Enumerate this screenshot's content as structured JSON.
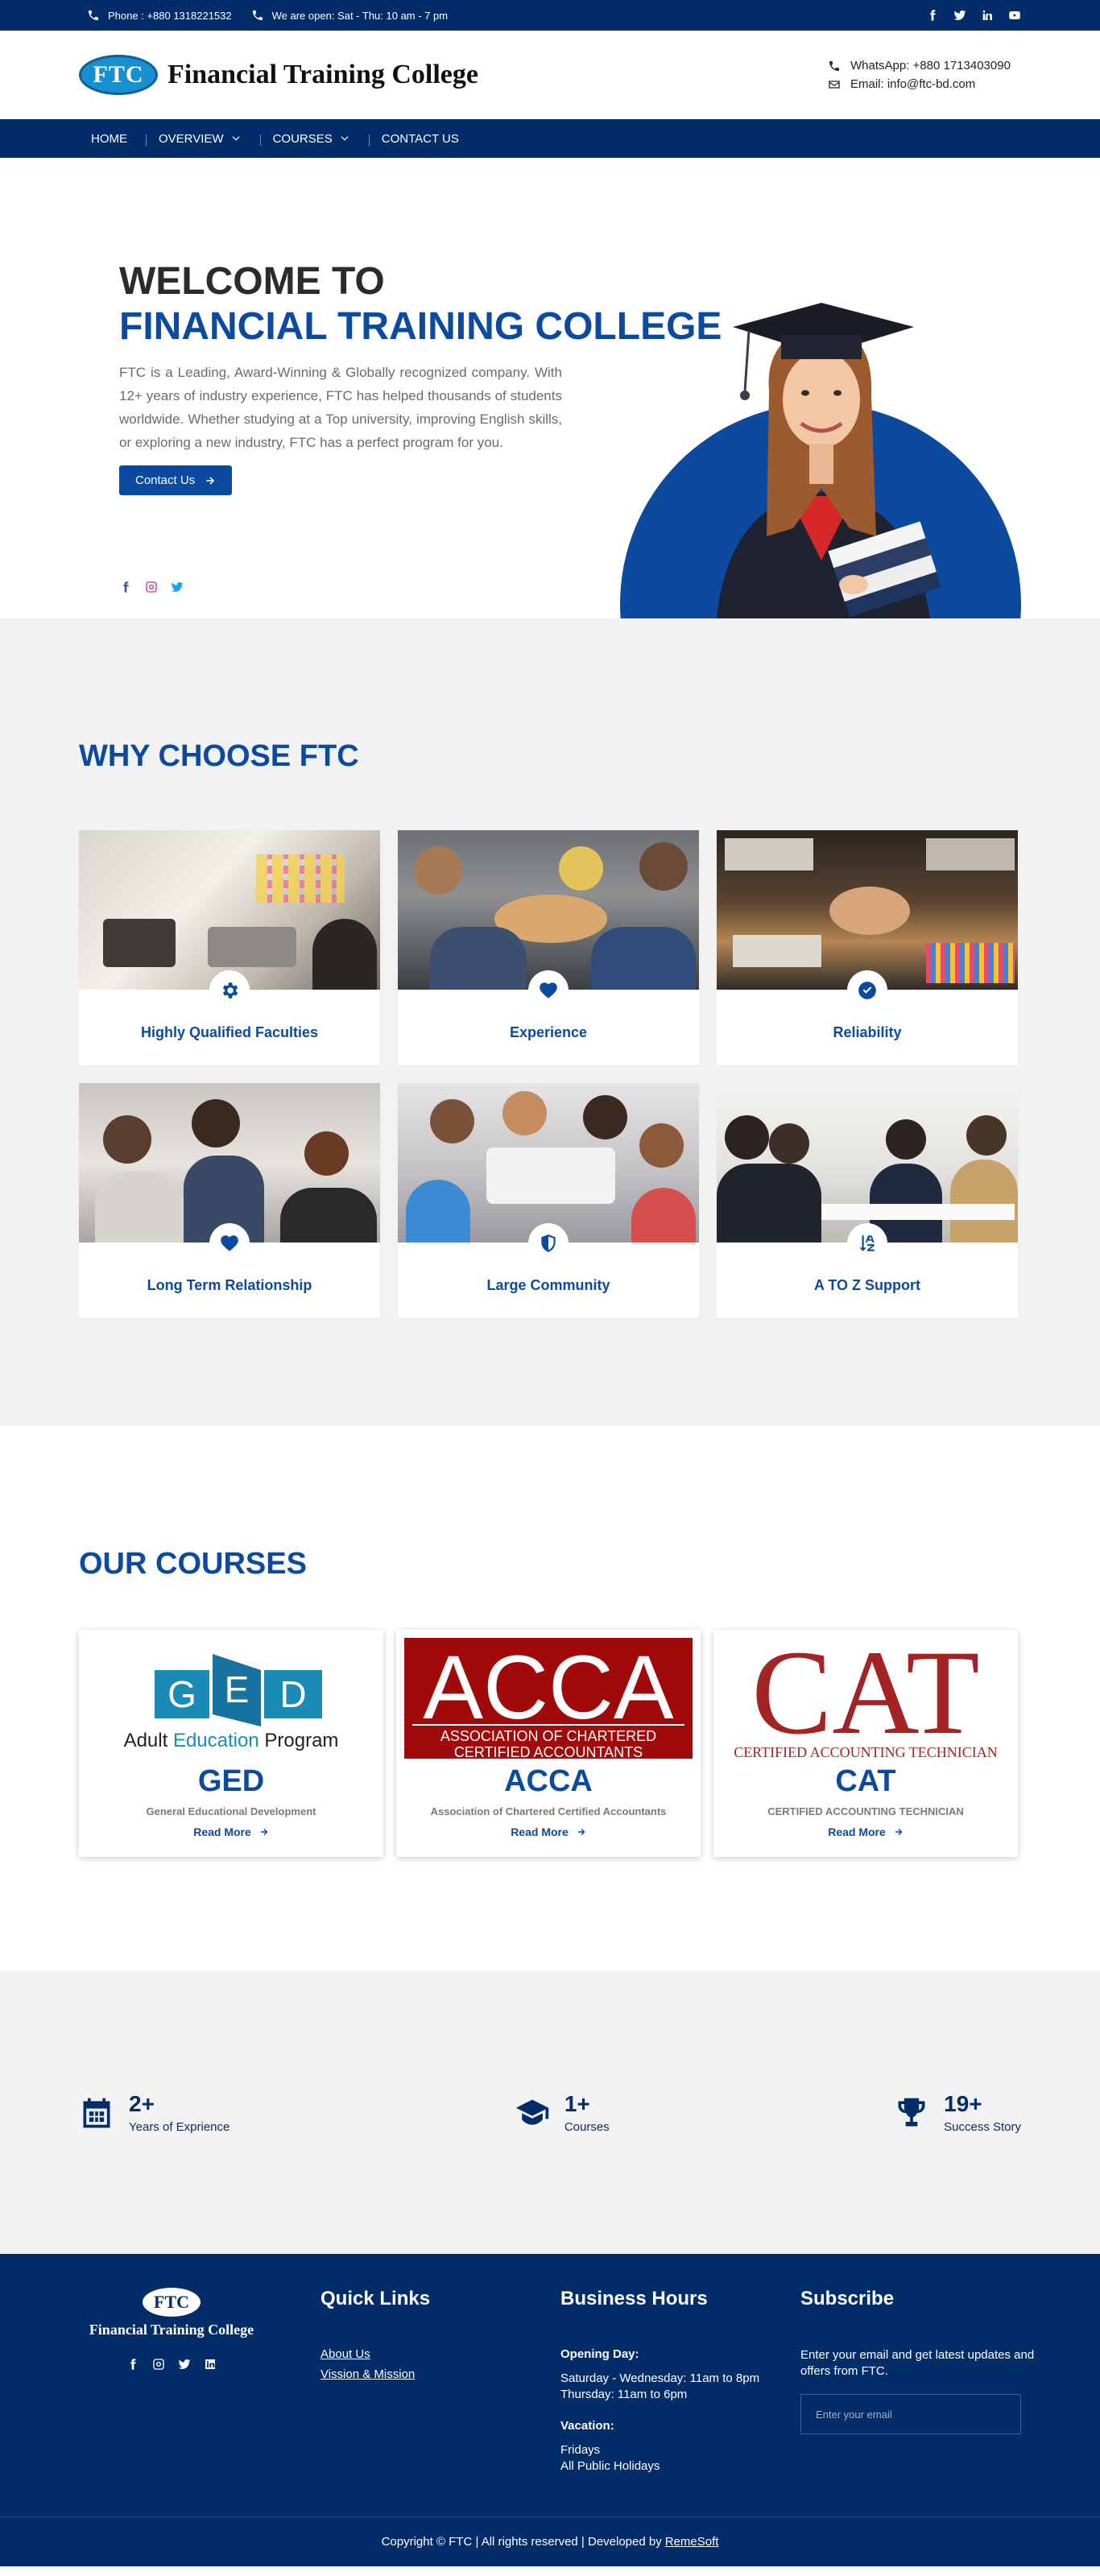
{
  "topbar": {
    "phone": "Phone : +880 1318221532",
    "hours": "We are open: Sat - Thu: 10 am - 7 pm"
  },
  "header": {
    "logo_abbr": "FTC",
    "logo_name": "Financial Training College",
    "whatsapp": "WhatsApp: +880 1713403090",
    "email": "Email: info@ftc-bd.com"
  },
  "nav": {
    "home": "HOME",
    "overview": "OVERVIEW",
    "courses": "COURSES",
    "contact": "CONTACT US"
  },
  "hero": {
    "line1": "WELCOME TO",
    "line2": "FINANCIAL TRAINING COLLEGE",
    "description": "FTC is a Leading, Award-Winning & Globally recognized company. With 12+ years of industry experience, FTC has helped thousands of students worldwide. Whether studying at a Top university, improving English skills, or exploring a new industry, FTC has a perfect program for you.",
    "cta": "Contact Us"
  },
  "why": {
    "title": "WHY CHOOSE FTC",
    "cards": [
      {
        "title": "Highly Qualified Faculties",
        "icon": "gear-icon"
      },
      {
        "title": "Experience",
        "icon": "heart-icon"
      },
      {
        "title": "Reliability",
        "icon": "check-circle-icon"
      },
      {
        "title": "Long Term Relationship",
        "icon": "heart-icon"
      },
      {
        "title": "Large Community",
        "icon": "shield-icon"
      },
      {
        "title": "A TO Z Support",
        "icon": "sort-az-icon"
      }
    ]
  },
  "courses": {
    "title": "OUR COURSES",
    "items": [
      {
        "name": "GED",
        "subtitle": "General Educational Development",
        "more": "Read More",
        "logo_letters": [
          "G",
          "E",
          "D"
        ],
        "logo_caption_1": "Adult",
        "logo_caption_2": "Education",
        "logo_caption_3": "Program"
      },
      {
        "name": "ACCA",
        "subtitle": "Association of Chartered Certified Accountants",
        "more": "Read More",
        "logo_word": "ACCA",
        "logo_caption_1": "ASSOCIATION OF CHARTERED",
        "logo_caption_2": "CERTIFIED ACCOUNTANTS"
      },
      {
        "name": "CAT",
        "subtitle": "CERTIFIED ACCOUNTING TECHNICIAN",
        "more": "Read More",
        "logo_word": "CAT",
        "logo_caption_1": "CERTIFIED ACCOUNTING TECHNICIAN"
      }
    ]
  },
  "stats": [
    {
      "number": "2+",
      "label": "Years of Exprience",
      "icon": "calendar-icon"
    },
    {
      "number": "1+",
      "label": "Courses",
      "icon": "graduation-cap-icon"
    },
    {
      "number": "19+",
      "label": "Success Story",
      "icon": "trophy-icon"
    }
  ],
  "footer": {
    "logo_abbr": "FTC",
    "logo_name": "Financial Training College",
    "quick_links_title": "Quick Links",
    "links": [
      "About Us",
      "Vission & Mission"
    ],
    "hours_title": "Business Hours",
    "opening_label": "Opening Day:",
    "opening_text": "Saturday - Wednesday: 11am to 8pm\nThursday: 11am to 6pm",
    "vacation_label": "Vacation:",
    "vacation_text": "Fridays\nAll Public Holidays",
    "subscribe_title": "Subscribe",
    "subscribe_text": "Enter your email and get latest updates and offers from FTC.",
    "email_placeholder": "Enter your email",
    "copyright": "Copyright © FTC | All rights reserved | Developed by",
    "developer": "RemeSoft"
  },
  "colors": {
    "primary": "#032d68",
    "accent": "#0b4a9e",
    "section_bg": "#f3f2f3"
  }
}
